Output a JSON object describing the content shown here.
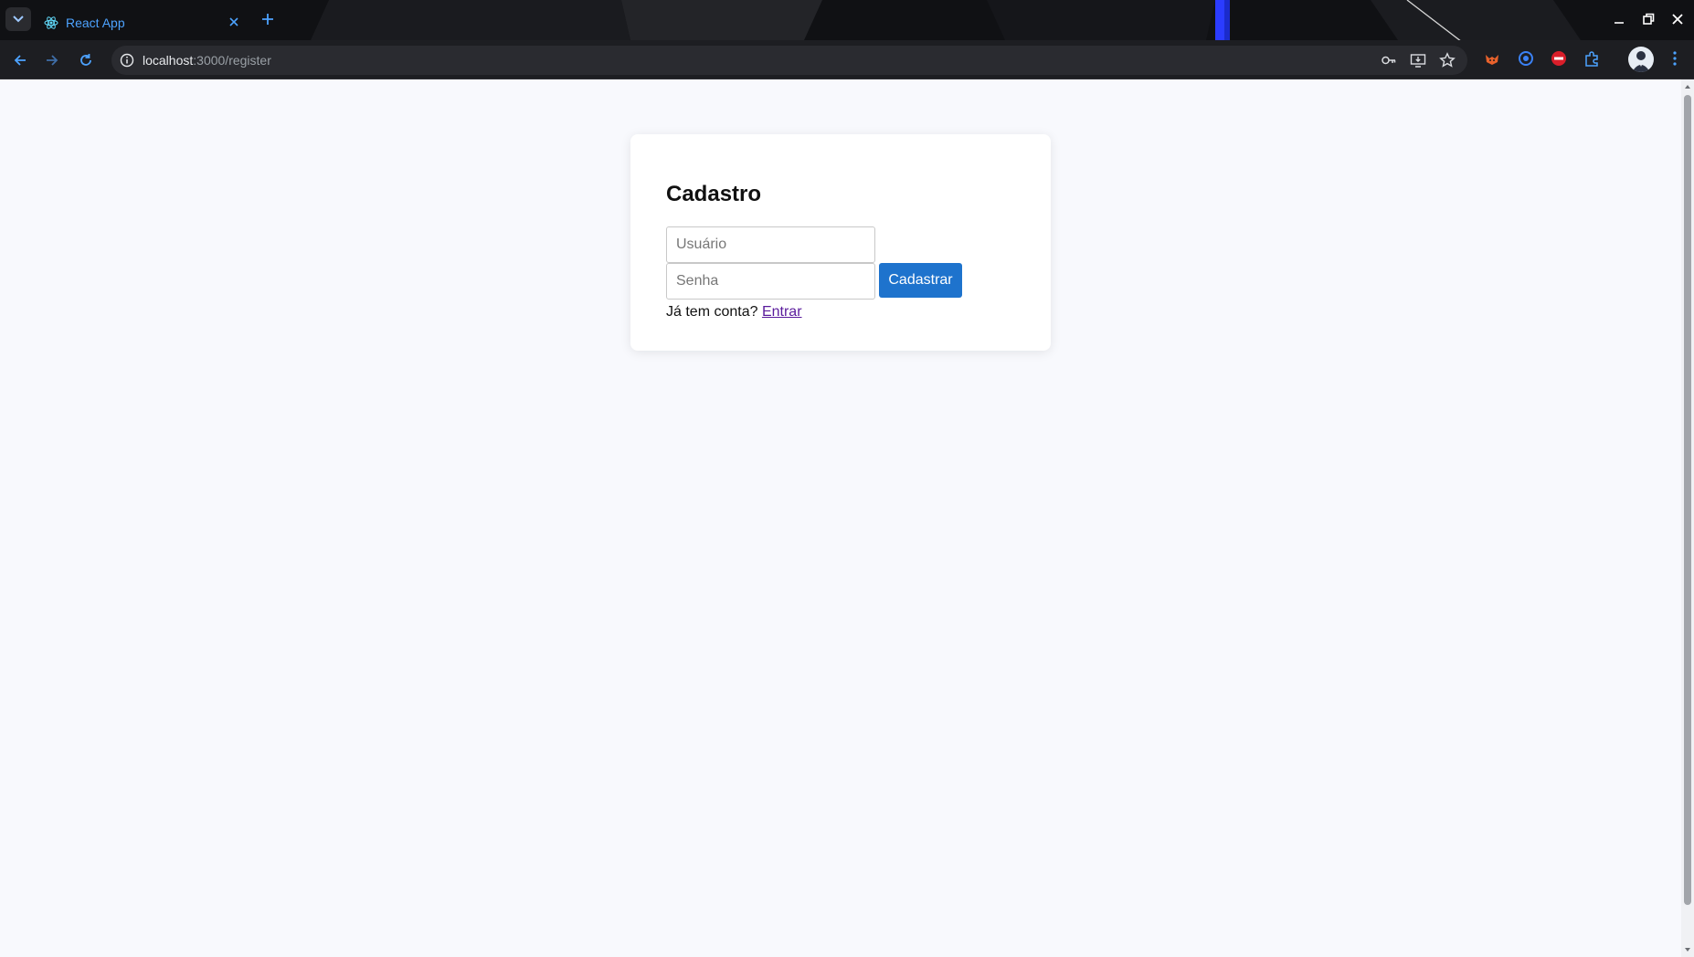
{
  "browser": {
    "tab_title": "React App",
    "url_host": "localhost",
    "url_path": ":3000/register",
    "accent": "#4da3ff"
  },
  "icons": {
    "tab_dropdown": "chevron-down-icon",
    "favicon": "react-logo-icon",
    "tab_close": "close-icon",
    "new_tab": "plus-icon",
    "minimize": "minimize-icon",
    "restore": "restore-icon",
    "window_close": "close-icon",
    "back": "arrow-left-icon",
    "forward": "arrow-right-icon",
    "reload": "reload-icon",
    "site_info": "info-icon",
    "password": "key-icon",
    "install": "install-app-icon",
    "bookmark": "star-icon",
    "extensions": "puzzle-icon",
    "menu": "kebab-menu-icon"
  },
  "form": {
    "heading": "Cadastro",
    "username": {
      "placeholder": "Usuário",
      "value": ""
    },
    "password": {
      "placeholder": "Senha",
      "value": ""
    },
    "submit_label": "Cadastrar",
    "footer_text": "Já tem conta?",
    "footer_link": "Entrar",
    "button_color": "#1e73cd",
    "link_color": "#5a1b9c"
  }
}
